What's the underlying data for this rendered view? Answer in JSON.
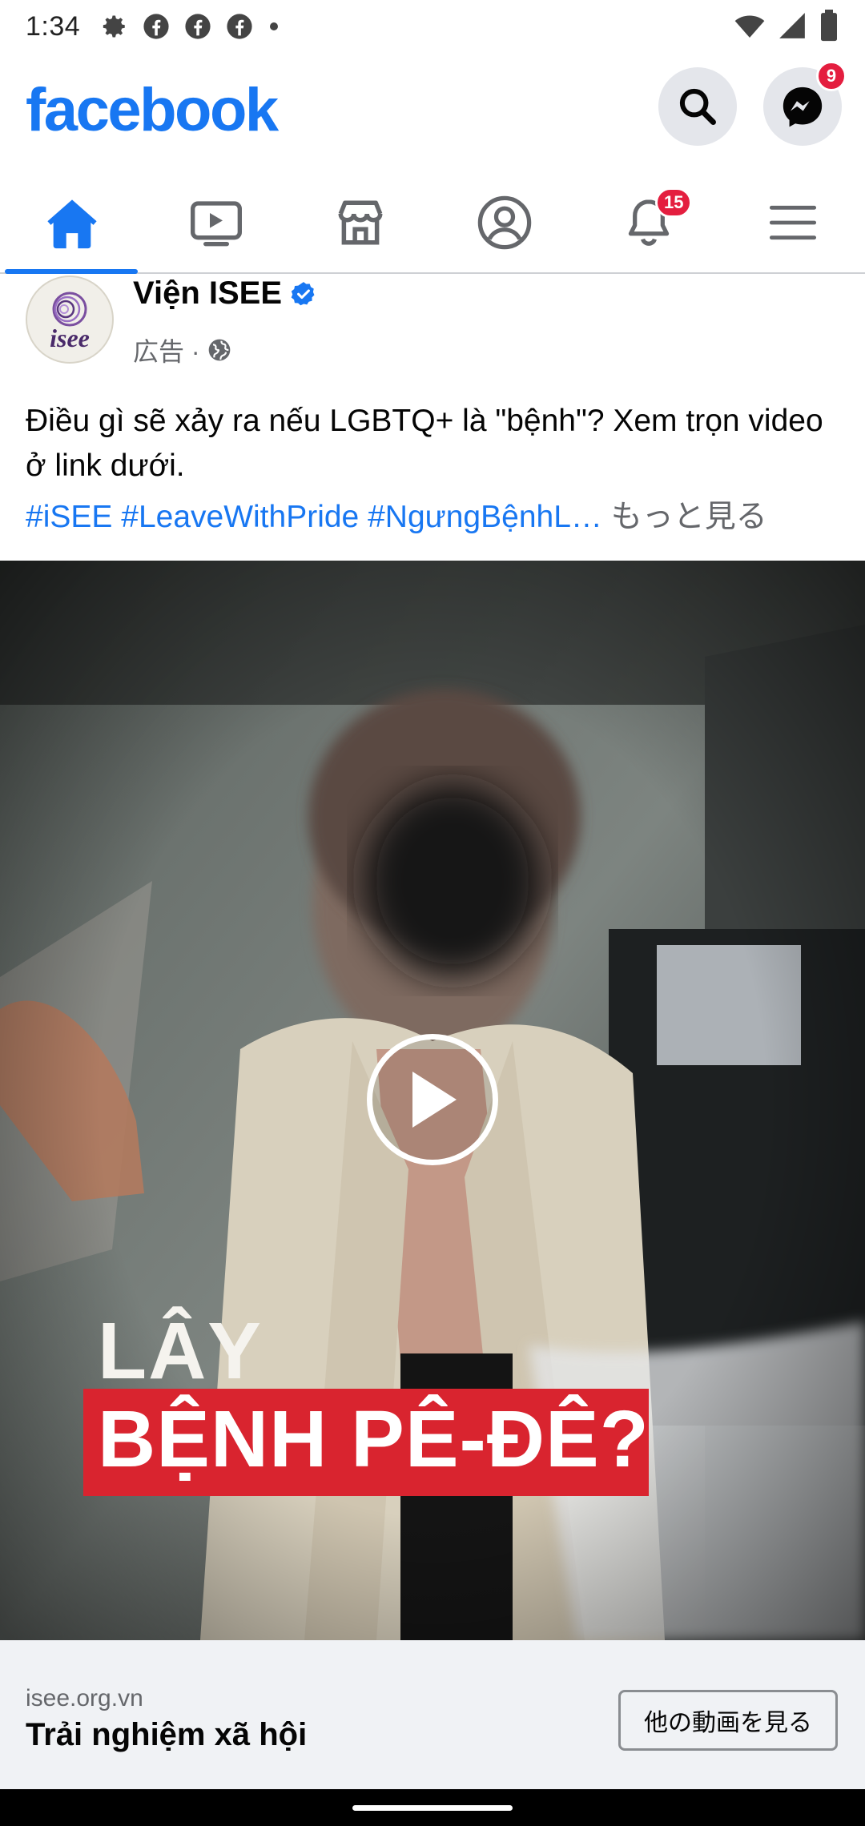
{
  "status_bar": {
    "time": "1:34",
    "left_icons": [
      "settings-icon",
      "facebook-icon",
      "facebook-icon",
      "facebook-icon",
      "dot-icon"
    ],
    "right_icons": [
      "wifi-icon",
      "signal-icon",
      "battery-icon"
    ]
  },
  "header": {
    "logo": "facebook",
    "search_icon": "search-icon",
    "messenger_icon": "messenger-icon",
    "messenger_badge": "9"
  },
  "tabs": [
    {
      "name": "home",
      "icon": "home-icon",
      "active": true
    },
    {
      "name": "video",
      "icon": "video-icon",
      "active": false
    },
    {
      "name": "marketplace",
      "icon": "marketplace-icon",
      "active": false
    },
    {
      "name": "profile",
      "icon": "profile-icon",
      "active": false
    },
    {
      "name": "notifications",
      "icon": "bell-icon",
      "active": false,
      "badge": "15"
    },
    {
      "name": "menu",
      "icon": "menu-icon",
      "active": false
    }
  ],
  "post": {
    "page_name": "Viện ISEE",
    "avatar_text": "isee",
    "sponsored": "広告 ·",
    "caption": "Điều gì sẽ xảy ra nếu LGBTQ+ là \"bệnh\"? Xem trọn video ở link dưới.",
    "hashtags": [
      "#iSEE",
      "#LeaveWithPride",
      "#NgưngBệnhL…"
    ],
    "see_more": "もっと見る",
    "video_overlay": {
      "line1": "LÂY",
      "line2": "BỆNH PÊ-ĐÊ?"
    },
    "link": {
      "domain": "isee.org.vn",
      "title": "Trải nghiệm xã hội",
      "cta": "他の動画を見る"
    }
  },
  "colors": {
    "brand_blue": "#1877f2",
    "badge_red": "#e41e3f",
    "overlay_red": "#d9242f",
    "link_bar_bg": "#f0f2f5"
  }
}
